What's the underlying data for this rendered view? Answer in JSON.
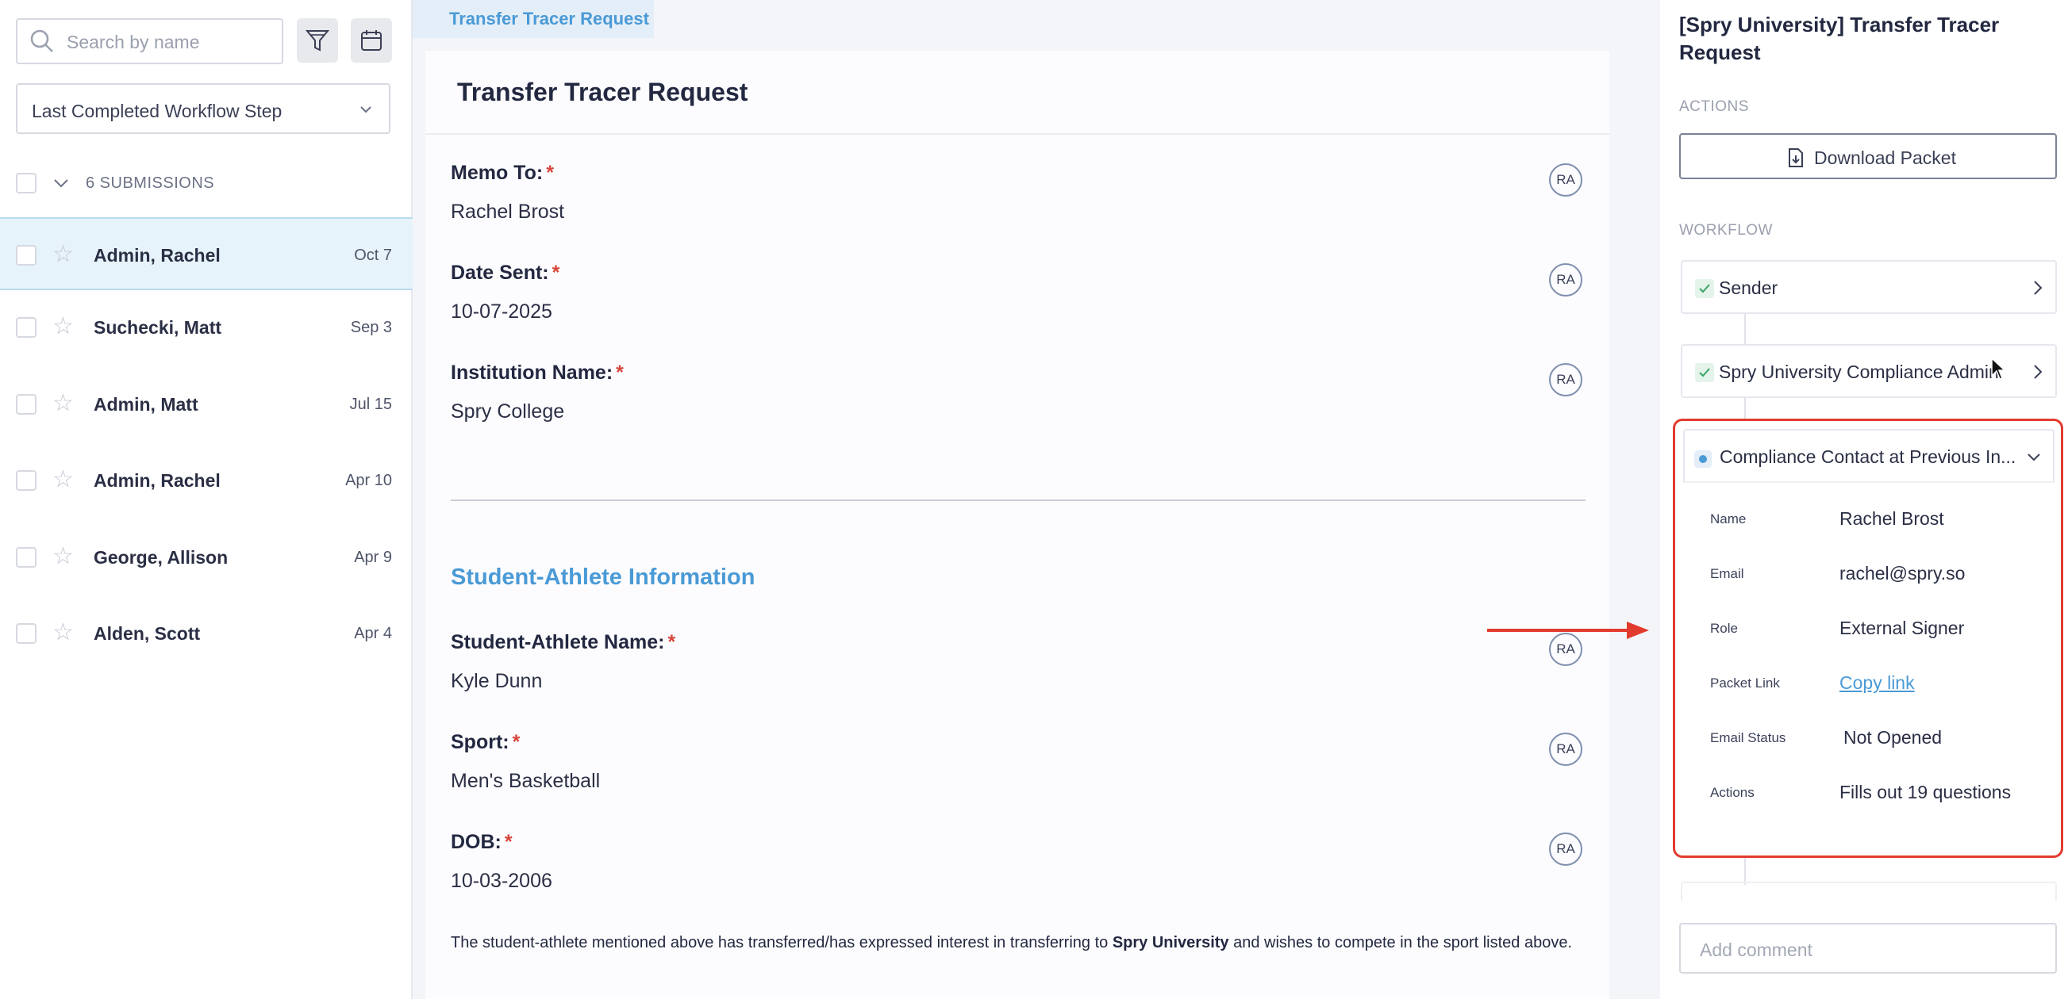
{
  "sidebar": {
    "search_placeholder": "Search by name",
    "workflow_filter": "Last Completed Workflow Step",
    "submissions_count": "6 SUBMISSIONS",
    "rows": [
      {
        "name": "Admin, Rachel",
        "date": "Oct 7",
        "selected": true
      },
      {
        "name": "Suchecki, Matt",
        "date": "Sep 3",
        "selected": false
      },
      {
        "name": "Admin, Matt",
        "date": "Jul 15",
        "selected": false
      },
      {
        "name": "Admin, Rachel",
        "date": "Apr 10",
        "selected": false
      },
      {
        "name": "George, Allison",
        "date": "Apr 9",
        "selected": false
      },
      {
        "name": "Alden, Scott",
        "date": "Apr 4",
        "selected": false
      }
    ]
  },
  "main": {
    "tab_label": "Transfer Tracer Request",
    "form_title": "Transfer Tracer Request",
    "fields": [
      {
        "label": "Memo To:",
        "value": "Rachel Brost",
        "initials": "RA"
      },
      {
        "label": "Date Sent:",
        "value": "10-07-2025",
        "initials": "RA"
      },
      {
        "label": "Institution Name:",
        "value": "Spry College",
        "initials": "RA"
      }
    ],
    "section_title": "Student-Athlete Information",
    "athlete_fields": [
      {
        "label": "Student-Athlete Name:",
        "value": "Kyle Dunn",
        "initials": "RA"
      },
      {
        "label": "Sport:",
        "value": "Men's Basketball",
        "initials": "RA"
      },
      {
        "label": "DOB:",
        "value": "10-03-2006",
        "initials": "RA"
      }
    ],
    "required_mark": "*",
    "paragraph": {
      "before": "The student-athlete mentioned above has transferred/has expressed interest in transferring to ",
      "bold": "Spry University",
      "after": " and wishes to compete in the sport listed above."
    }
  },
  "panel": {
    "title": "[Spry University] Transfer Tracer Request",
    "actions_label": "ACTIONS",
    "download_label": "Download Packet",
    "workflow_label": "WORKFLOW",
    "steps": [
      {
        "label": "Sender",
        "status": "complete"
      },
      {
        "label": "Spry University Compliance Admin",
        "status": "complete"
      }
    ],
    "expanded_step": {
      "label": "Compliance Contact at Previous In...",
      "status": "in-progress",
      "details": [
        {
          "key": "Name",
          "value": "Rachel Brost"
        },
        {
          "key": "Email",
          "value": "rachel@spry.so"
        },
        {
          "key": "Role",
          "value": "External Signer"
        },
        {
          "key": "Packet Link",
          "value": "Copy link"
        },
        {
          "key": "Email Status",
          "value": "Not Opened"
        },
        {
          "key": "Actions",
          "value": "Fills out 19 questions"
        }
      ]
    },
    "comment_placeholder": "Add comment"
  },
  "colors": {
    "accent": "#4a9ad6",
    "highlight": "#e23b2e",
    "selected_row": "#e6f3fa",
    "required": "#d8453b"
  }
}
